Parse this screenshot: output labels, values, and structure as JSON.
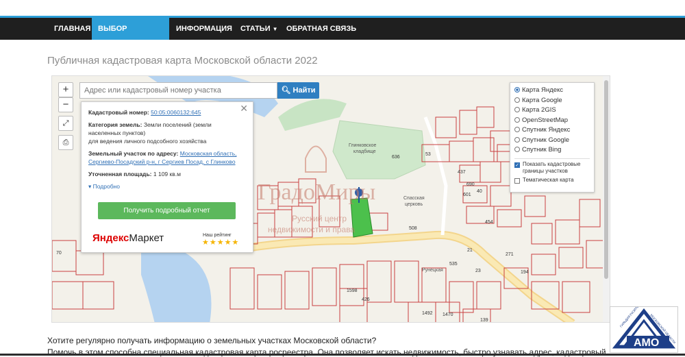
{
  "nav": {
    "items": [
      {
        "label": "ГЛАВНАЯ"
      },
      {
        "label": "ВЫБОР РЕГИОНА"
      },
      {
        "label": "ИНФОРМАЦИЯ"
      },
      {
        "label": "СТАТЬИ"
      },
      {
        "label": "ОБРАТНАЯ СВЯЗЬ"
      }
    ],
    "accent": "#2d9fd8"
  },
  "page_title": "Публичная кадастровая карта Московской области 2022",
  "map": {
    "search_placeholder": "Адрес или кадастровый номер участка",
    "search_button": "Найти",
    "zoom_in": "+",
    "zoom_out": "−",
    "popup": {
      "cad_label": "Кадастровый номер:",
      "cad_value": "50:05:0060132:645",
      "cat_label": "Категория земель:",
      "cat_value_1": "Земли поселений (земли",
      "cat_value_2": "населенных пунктов)",
      "cat_value_3": "для ведения личного подсобного хозяйства",
      "addr_label": "Земельный участок по адресу:",
      "addr_value_1": "Московская область,",
      "addr_value_2": "Сергиево-Посадский р-н, г Сергиев Посад, с Глинково",
      "area_label": "Уточненная площадь:",
      "area_value": "1 109 кв.м",
      "more": "▾ Подробно",
      "report_button": "Получить подробный отчет",
      "market_brand_1": "Яндекс",
      "market_brand_2": "Маркет",
      "rating_label": "Наш рейтинг",
      "stars": "★★★★★",
      "stars_value": 5
    },
    "layers": {
      "options": [
        "Карта Яндекс",
        "Карта Google",
        "Карта 2GIS",
        "OpenStreetMap",
        "Спутник Яндекс",
        "Спутник Google",
        "Спутник Bing"
      ],
      "selected": "Карта Яндекс",
      "checks": [
        {
          "label_1": "Показать кадастровые",
          "label_2": "границы участков",
          "checked": true
        },
        {
          "label_1": "Тематическая карта",
          "label_2": "",
          "checked": false
        }
      ]
    },
    "labels": {
      "cemetery_1": "Глинковское",
      "cemetery_2": "кладбище",
      "church_1": "Спасская",
      "church_2": "церковь",
      "street": "Рунецкая",
      "watermark_1": "ГрадоМиры",
      "watermark_2": "Русский центр",
      "watermark_3": "недвижимости и права",
      "parcels": [
        "636",
        "53",
        "437",
        "690",
        "601",
        "40",
        "454",
        "271",
        "194",
        "70",
        "1598",
        "426",
        "1492",
        "1470",
        "139",
        "535",
        "508",
        "21",
        "23"
      ]
    }
  },
  "paragraph_1": "Хотите регулярно получать информацию о земельных участках Московской области?",
  "paragraph_2": "Помочь в этом способна специальная кадастровая карта росреестра. Она позволяет искать недвижимость, быстро узнавать адрес, кадастровый",
  "logo": {
    "text": "АМО",
    "arc_1": "ГИЛЬДИЯ РИЭЛТОРОВ",
    "arc_2": "МОСКОВСКОЙ ОБЛАСТИ"
  }
}
